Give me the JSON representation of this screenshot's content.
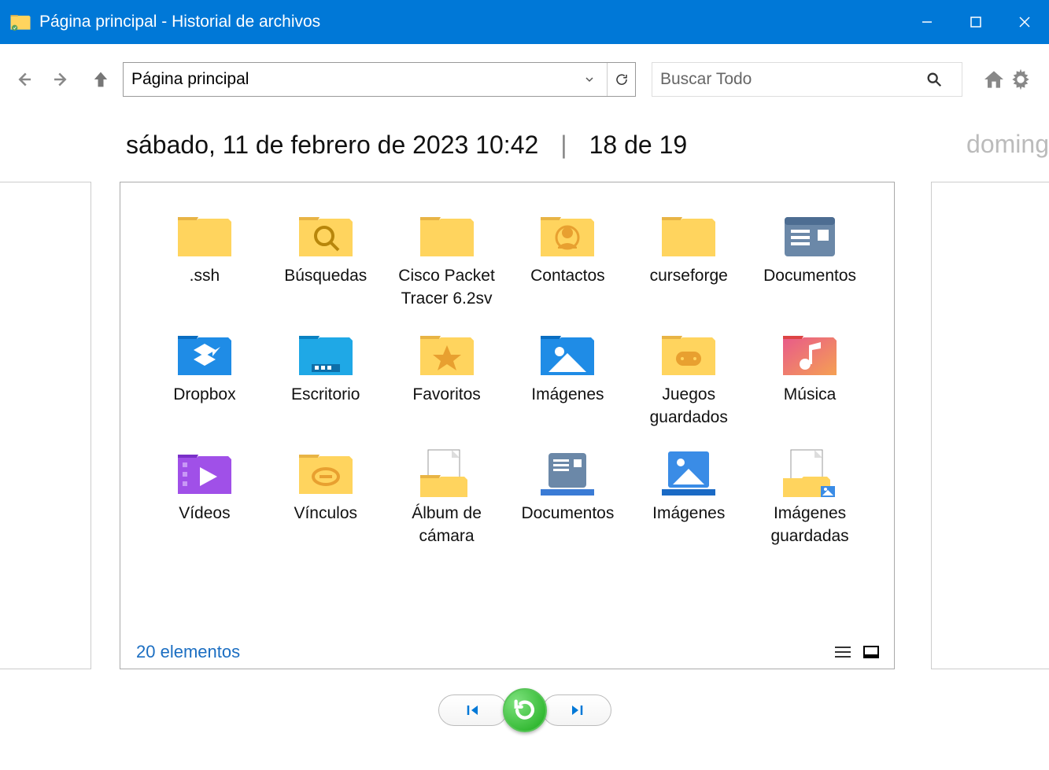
{
  "titlebar": {
    "title": "Página principal - Historial de archivos"
  },
  "toolbar": {
    "address": "Página principal",
    "search_placeholder": "Buscar Todo"
  },
  "header": {
    "date_text": "sábado, 11 de febrero de 2023 10:42",
    "position": "18 de 19",
    "next_preview": "doming"
  },
  "items": [
    {
      "label": ".ssh",
      "icon": "folder"
    },
    {
      "label": "Búsquedas",
      "icon": "folder-search"
    },
    {
      "label": "Cisco Packet Tracer 6.2sv",
      "icon": "folder"
    },
    {
      "label": "Contactos",
      "icon": "folder-contacts"
    },
    {
      "label": "curseforge",
      "icon": "folder"
    },
    {
      "label": "Documentos",
      "icon": "documents-lib"
    },
    {
      "label": "Dropbox",
      "icon": "folder-dropbox"
    },
    {
      "label": "Escritorio",
      "icon": "folder-desktop"
    },
    {
      "label": "Favoritos",
      "icon": "folder-star"
    },
    {
      "label": "Imágenes",
      "icon": "folder-pictures"
    },
    {
      "label": "Juegos guardados",
      "icon": "folder-games"
    },
    {
      "label": "Música",
      "icon": "folder-music"
    },
    {
      "label": "Vídeos",
      "icon": "folder-videos"
    },
    {
      "label": "Vínculos",
      "icon": "folder-links"
    },
    {
      "label": "Álbum de cámara",
      "icon": "library-camera"
    },
    {
      "label": "Documentos",
      "icon": "library-docs"
    },
    {
      "label": "Imágenes",
      "icon": "library-pics"
    },
    {
      "label": "Imágenes guardadas",
      "icon": "library-saved"
    }
  ],
  "status": {
    "count_text": "20 elementos"
  }
}
